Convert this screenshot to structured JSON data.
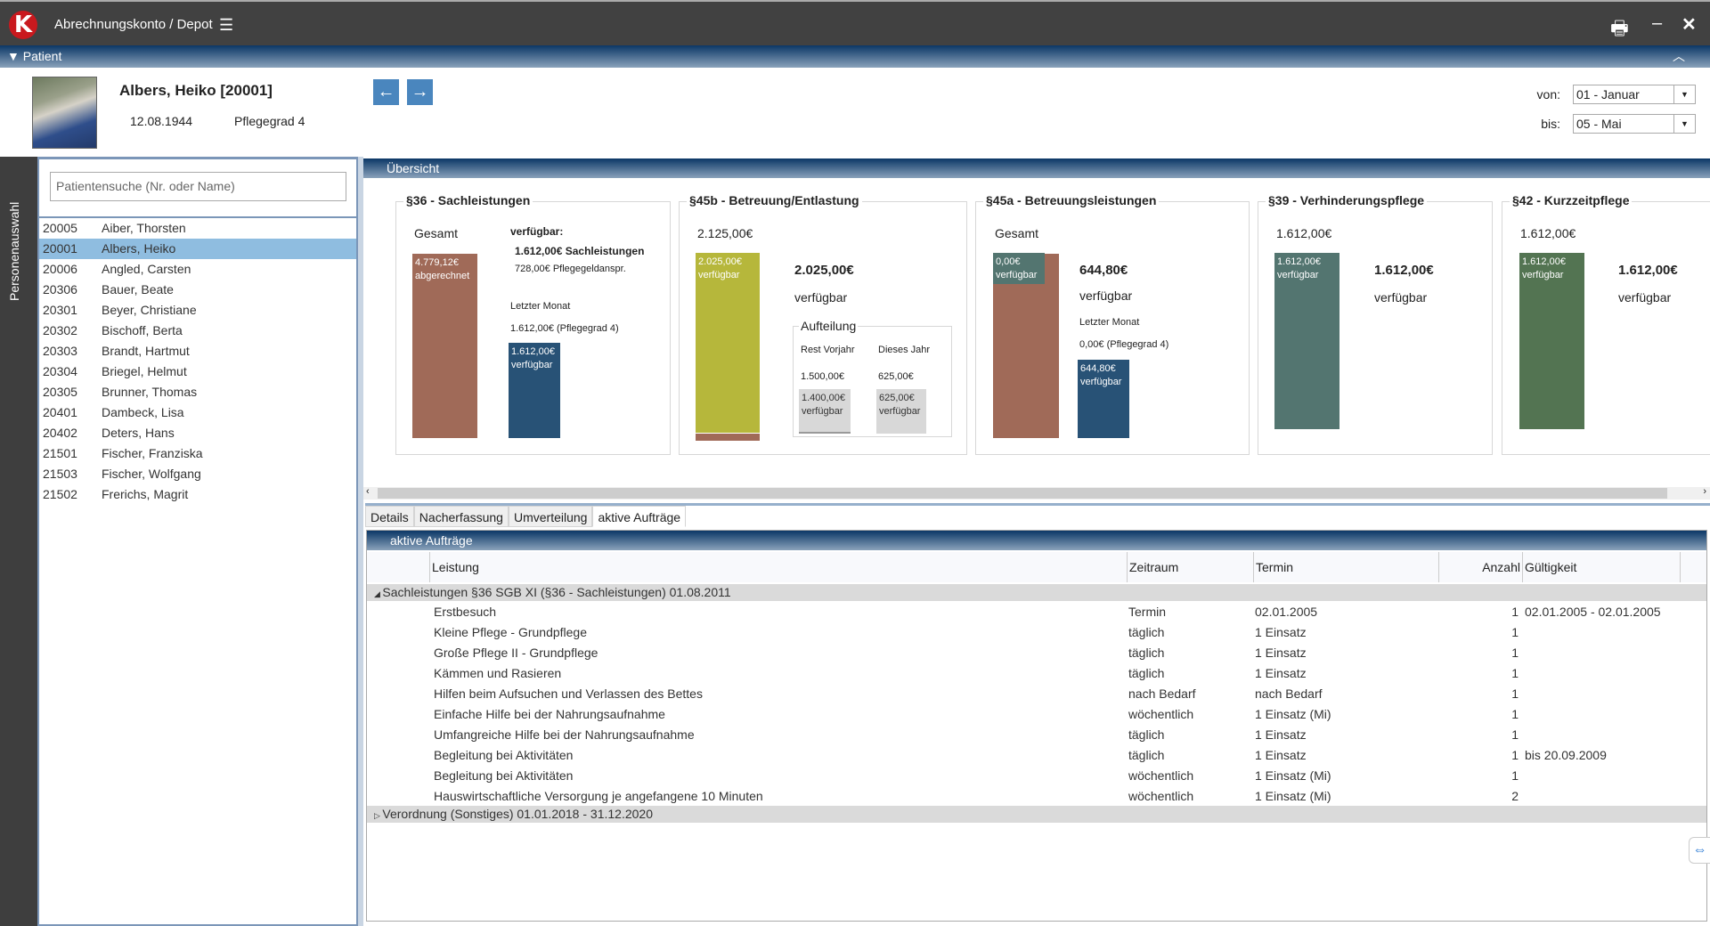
{
  "app": {
    "title": "Abrechnungskonto / Depot",
    "logo_letter": "K"
  },
  "patient_section": {
    "label": "Patient"
  },
  "patient": {
    "name": "Albers, Heiko [20001]",
    "dob": "12.08.1944",
    "pflegegrad": "Pflegegrad 4"
  },
  "period": {
    "von_label": "von:",
    "von_value": "01 - Januar",
    "bis_label": "bis:",
    "bis_value": "05 - Mai"
  },
  "sidebar": {
    "vertical_label": "Personenauswahl",
    "search_placeholder": "Patientensuche (Nr. oder Name)",
    "patients": [
      {
        "nr": "20005",
        "name": "Aiber, Thorsten"
      },
      {
        "nr": "20001",
        "name": "Albers, Heiko",
        "selected": true
      },
      {
        "nr": "20006",
        "name": "Angled, Carsten"
      },
      {
        "nr": "20306",
        "name": "Bauer, Beate"
      },
      {
        "nr": "20301",
        "name": "Beyer, Christiane"
      },
      {
        "nr": "20302",
        "name": "Bischoff, Berta"
      },
      {
        "nr": "20303",
        "name": "Brandt, Hartmut"
      },
      {
        "nr": "20304",
        "name": "Briegel, Helmut"
      },
      {
        "nr": "20305",
        "name": "Brunner, Thomas"
      },
      {
        "nr": "20401",
        "name": "Dambeck, Lisa"
      },
      {
        "nr": "20402",
        "name": "Deters, Hans"
      },
      {
        "nr": "21501",
        "name": "Fischer, Franziska"
      },
      {
        "nr": "21503",
        "name": "Fischer, Wolfgang"
      },
      {
        "nr": "21502",
        "name": "Frerichs, Magrit"
      }
    ]
  },
  "overview": {
    "title": "Übersicht",
    "c36": {
      "title": "§36 - Sachleistungen",
      "gesamt": "Gesamt",
      "bar1_value": "4.779,12€",
      "bar1_label": "abgerechnet",
      "verfuegbar_label": "verfügbar:",
      "sach": "1.612,00€ Sachleistungen",
      "pflegegeld": "728,00€ Pflegegeldanspr.",
      "letzter_monat": "Letzter Monat",
      "monat_value": "1.612,00€ (Pflegegrad 4)",
      "bar2_value": "1.612,00€",
      "bar2_label": "verfügbar"
    },
    "c45b": {
      "title": "§45b - Betreuung/Entlastung",
      "total": "2.125,00€",
      "bar_value": "2.025,00€",
      "bar_label": "verfügbar",
      "big": "2.025,00€",
      "big_label": "verfügbar",
      "aufteilung": "Aufteilung",
      "rest_label": "Rest Vorjahr",
      "dieses_label": "Dieses Jahr",
      "rest_value": "1.500,00€",
      "dieses_value": "625,00€",
      "rest_bar_value": "1.400,00€",
      "rest_bar_label": "verfügbar",
      "dieses_bar_value": "625,00€",
      "dieses_bar_label": "verfügbar"
    },
    "c45a": {
      "title": "§45a - Betreuungsleistungen",
      "gesamt": "Gesamt",
      "bar1_value": "0,00€",
      "bar1_label": "verfügbar",
      "big": "644,80€",
      "big_label": "verfügbar",
      "letzter_monat": "Letzter Monat",
      "monat_value": "0,00€ (Pflegegrad 4)",
      "bar2_value": "644,80€",
      "bar2_label": "verfügbar"
    },
    "c39": {
      "title": "§39 - Verhinderungspflege",
      "total": "1.612,00€",
      "bar_value": "1.612,00€",
      "bar_label": "verfügbar",
      "big": "1.612,00€",
      "big_label": "verfügbar"
    },
    "c42": {
      "title": "§42 - Kurzzeitpflege",
      "total": "1.612,00€",
      "bar_value": "1.612,00€",
      "bar_label": "verfügbar",
      "big": "1.612,00€",
      "big_label": "verfügbar"
    }
  },
  "tabs": [
    "Details",
    "Nacherfassung",
    "Umverteilung",
    "aktive Aufträge"
  ],
  "active_tab": 3,
  "orders": {
    "title": "aktive Aufträge",
    "columns": {
      "leistung": "Leistung",
      "zeitraum": "Zeitraum",
      "termin": "Termin",
      "anzahl": "Anzahl",
      "gueltigkeit": "Gültigkeit"
    },
    "group1": "Sachleistungen §36 SGB XI (§36 - Sachleistungen) 01.08.2011",
    "rows": [
      {
        "leistung": "Erstbesuch",
        "zeitraum": "Termin",
        "termin": "02.01.2005",
        "anzahl": "1",
        "gueltigkeit": "02.01.2005 - 02.01.2005"
      },
      {
        "leistung": "Kleine Pflege - Grundpflege",
        "zeitraum": "täglich",
        "termin": "1 Einsatz",
        "anzahl": "1",
        "gueltigkeit": ""
      },
      {
        "leistung": "Große Pflege II - Grundpflege",
        "zeitraum": "täglich",
        "termin": "1 Einsatz",
        "anzahl": "1",
        "gueltigkeit": ""
      },
      {
        "leistung": "Kämmen und Rasieren",
        "zeitraum": "täglich",
        "termin": "1 Einsatz",
        "anzahl": "1",
        "gueltigkeit": ""
      },
      {
        "leistung": "Hilfen beim Aufsuchen und Verlassen des Bettes",
        "zeitraum": "nach Bedarf",
        "termin": "nach Bedarf",
        "anzahl": "1",
        "gueltigkeit": ""
      },
      {
        "leistung": "Einfache Hilfe bei der Nahrungsaufnahme",
        "zeitraum": "wöchentlich",
        "termin": "1 Einsatz (Mi)",
        "anzahl": "1",
        "gueltigkeit": ""
      },
      {
        "leistung": "Umfangreiche Hilfe bei der Nahrungsaufnahme",
        "zeitraum": "täglich",
        "termin": "1 Einsatz",
        "anzahl": "1",
        "gueltigkeit": ""
      },
      {
        "leistung": "Begleitung bei Aktivitäten",
        "zeitraum": "täglich",
        "termin": "1 Einsatz",
        "anzahl": "1",
        "gueltigkeit": "bis 20.09.2009"
      },
      {
        "leistung": "Begleitung bei Aktivitäten",
        "zeitraum": "wöchentlich",
        "termin": "1 Einsatz (Mi)",
        "anzahl": "1",
        "gueltigkeit": ""
      },
      {
        "leistung": "Hauswirtschaftliche Versorgung je angefangene 10 Minuten",
        "zeitraum": "wöchentlich",
        "termin": "1 Einsatz (Mi)",
        "anzahl": "2",
        "gueltigkeit": ""
      }
    ],
    "group2": "Verordnung (Sonstiges) 01.01.2018 - 31.12.2020"
  },
  "colors": {
    "brown": "#a06a58",
    "blue": "#285276",
    "olive": "#b6b73b",
    "teal": "#537570",
    "green": "#537452",
    "grey": "#d8d8d8",
    "selected": "#8fbde0"
  }
}
